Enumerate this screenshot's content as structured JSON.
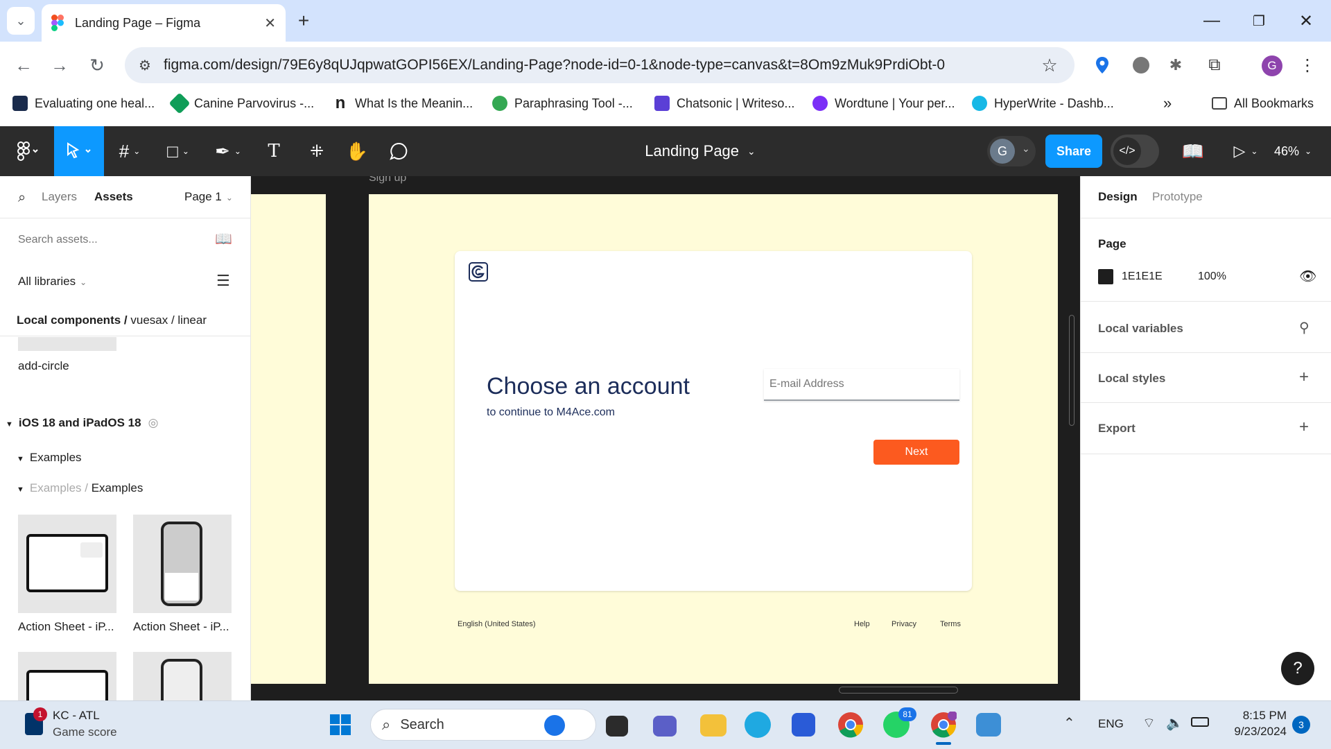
{
  "browser": {
    "tab_title": "Landing Page – Figma",
    "url": "figma.com/design/79E6y8qUJqpwatGOPI56EX/Landing-Page?node-id=0-1&node-type=canvas&t=8Om9zMuk9PrdiObt-0",
    "profile_initial": "G",
    "bookmarks": [
      "Evaluating one heal...",
      "Canine Parvovirus -...",
      "What Is the Meanin...",
      "Paraphrasing Tool -...",
      "Chatsonic | Writeso...",
      "Wordtune | Your per...",
      "HyperWrite - Dashb..."
    ],
    "all_bookmarks": "All Bookmarks"
  },
  "figma": {
    "file_title": "Landing Page",
    "avatar_initial": "G",
    "share_label": "Share",
    "zoom": "46%"
  },
  "left_panel": {
    "tab_layers": "Layers",
    "tab_assets": "Assets",
    "page_select": "Page 1",
    "search_placeholder": "Search assets...",
    "libraries": "All libraries",
    "breadcrumb_root": "Local components /",
    "breadcrumb_path": "vuesax / linear",
    "component_name": "add-circle",
    "section_title": "iOS 18 and iPadOS 18",
    "subsection": "Examples",
    "sub_breadcrumb_parent": "Examples /",
    "sub_breadcrumb_child": "Examples",
    "items": [
      "Action Sheet - iP...",
      "Action Sheet - iP..."
    ]
  },
  "canvas": {
    "frame_label": "Sign up",
    "card_heading": "Choose an account",
    "card_subtext": "to continue to M4Ace.com",
    "email_placeholder": "E-mail Address",
    "next_label": "Next",
    "footer_language": "English (United States)",
    "footer_help": "Help",
    "footer_privacy": "Privacy",
    "footer_terms": "Terms"
  },
  "right_panel": {
    "tab_design": "Design",
    "tab_prototype": "Prototype",
    "page_heading": "Page",
    "page_color": "1E1E1E",
    "page_opacity": "100%",
    "local_variables": "Local variables",
    "local_styles": "Local styles",
    "export": "Export",
    "help": "?"
  },
  "taskbar": {
    "widget_title": "KC - ATL",
    "widget_sub": "Game score",
    "widget_badge": "1",
    "search_label": "Search",
    "whatsapp_badge": "81",
    "lang": "ENG",
    "time": "8:15 PM",
    "date": "9/23/2024",
    "notif_count": "3"
  },
  "colors": {
    "figma_blue": "#0d99ff",
    "next_orange": "#fc5a1f",
    "frame_bg": "#fffcd9",
    "brand_navy": "#1c2d5a"
  }
}
